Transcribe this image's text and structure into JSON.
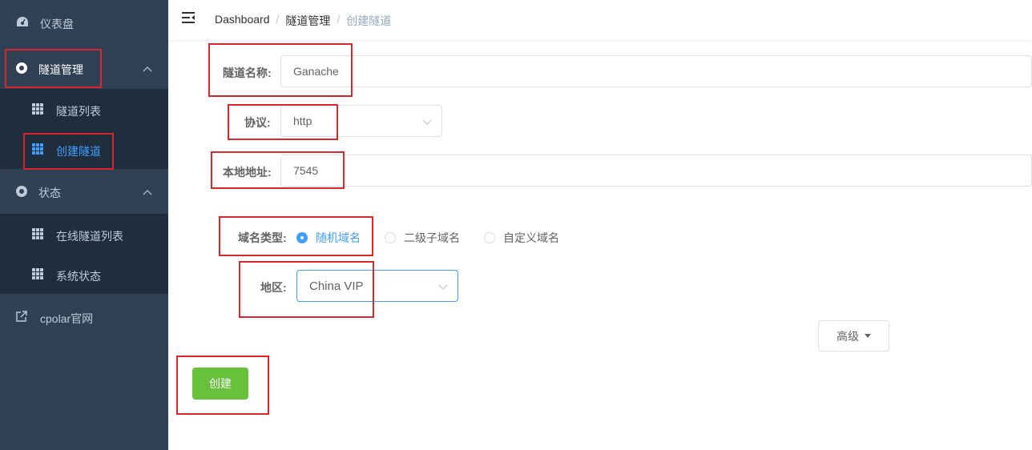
{
  "sidebar": {
    "dashboard": "仪表盘",
    "tunnel_mgmt": "隧道管理",
    "tunnel_list": "隧道列表",
    "create_tunnel": "创建隧道",
    "status": "状态",
    "online_tunnels": "在线隧道列表",
    "system_status": "系统状态",
    "website": "cpolar官网"
  },
  "breadcrumb": {
    "home": "Dashboard",
    "section": "隧道管理",
    "current": "创建隧道",
    "sep": "/"
  },
  "form": {
    "name_label": "隧道名称:",
    "name_value": "Ganache",
    "protocol_label": "协议:",
    "protocol_value": "http",
    "local_label": "本地地址:",
    "local_value": "7545",
    "domain_type_label": "域名类型:",
    "domain_options": [
      "随机域名",
      "二级子域名",
      "自定义域名"
    ],
    "domain_selected": "随机域名",
    "region_label": "地区:",
    "region_value": "China VIP",
    "advanced_button": "高级",
    "create_button": "创建"
  },
  "colors": {
    "sidebar_bg": "#304156",
    "submenu_bg": "#1f2d3d",
    "accent": "#409eff",
    "create_green": "#67c23a",
    "annotation_red": "#d9262c"
  }
}
